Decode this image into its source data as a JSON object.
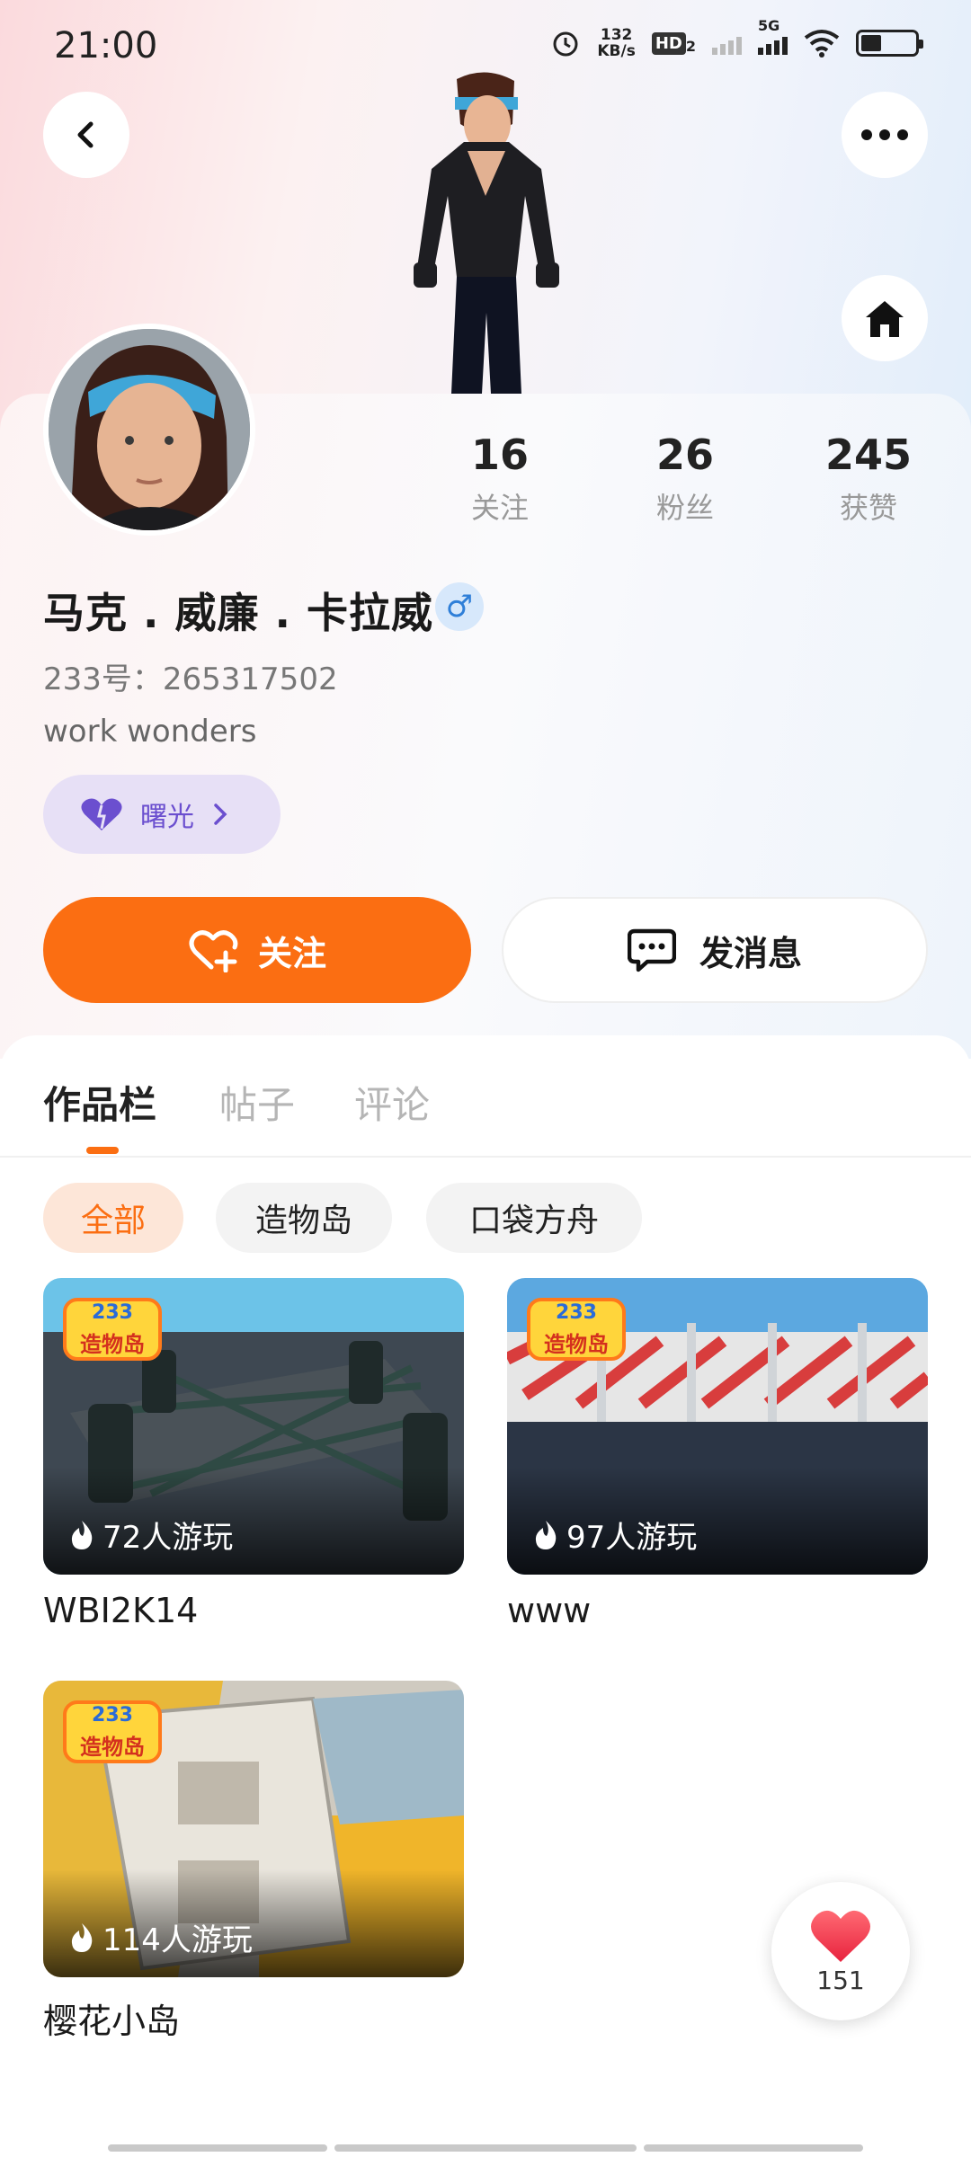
{
  "status_bar": {
    "time": "21:00",
    "net_speed_value": "132",
    "net_speed_unit": "KB/s",
    "hd_label": "HD",
    "hd_sub": "2",
    "network_type": "5G"
  },
  "profile": {
    "name": "马克 . 威廉 . 卡拉威",
    "gender_symbol": "♂",
    "id_line": "233号：265317502",
    "bio": "work wonders",
    "tag_label": "曙光",
    "stats": [
      {
        "value": "16",
        "label": "关注"
      },
      {
        "value": "26",
        "label": "粉丝"
      },
      {
        "value": "245",
        "label": "获赞"
      }
    ]
  },
  "actions": {
    "follow_label": "关注",
    "message_label": "发消息"
  },
  "tabs": [
    "作品栏",
    "帖子",
    "评论"
  ],
  "filters": [
    "全部",
    "造物岛",
    "口袋方舟"
  ],
  "works": [
    {
      "title": "WBI2K14",
      "plays": "72人游玩",
      "badge_top": "233",
      "badge_bottom": "造物岛"
    },
    {
      "title": "www",
      "plays": "97人游玩",
      "badge_top": "233",
      "badge_bottom": "造物岛"
    },
    {
      "title": "樱花小岛",
      "plays": "114人游玩",
      "badge_top": "233",
      "badge_bottom": "造物岛"
    }
  ],
  "like_count": "151",
  "colors": {
    "accent": "#fb6e12",
    "tag_purple": "#6b4fcf",
    "like_red": "#f0344a"
  }
}
